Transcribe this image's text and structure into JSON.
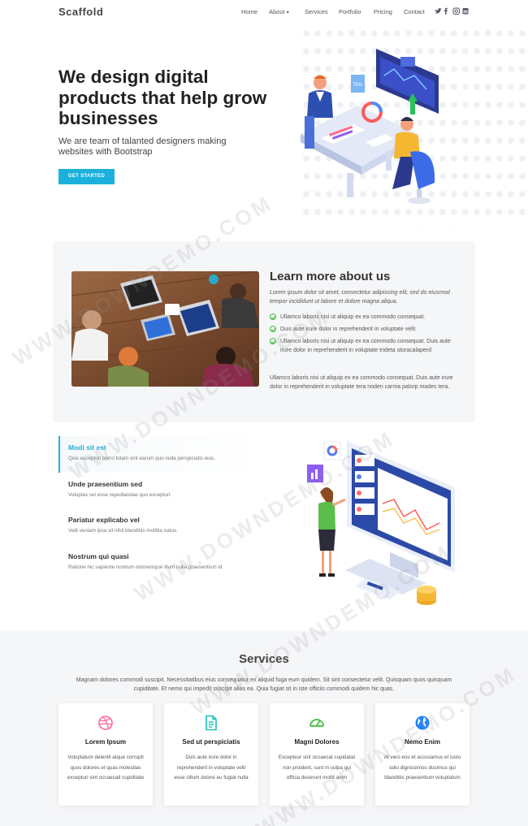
{
  "header": {
    "logo": "Scaffold",
    "nav": [
      {
        "label": "Home"
      },
      {
        "label": "About"
      },
      {
        "label": "Services"
      },
      {
        "label": "Portfolio"
      },
      {
        "label": "Pricing"
      },
      {
        "label": "Contact"
      }
    ],
    "social_icons": [
      "twitter-icon",
      "facebook-icon",
      "instagram-icon",
      "linkedin-icon"
    ]
  },
  "hero": {
    "title": "We design digital products that help grow businesses",
    "subtitle": "We are team of talanted designers making websites with Bootstrap",
    "cta_label": "GET STARTED",
    "badge_text": "75%"
  },
  "about": {
    "title": "Learn more about us",
    "intro": "Lorem ipsum dolor sit amet, consectetur adipiscing elit, sed do eiusmod tempor incididunt ut labore et dolore magna aliqua.",
    "checks": [
      "Ullamco laboris nisi ut aliquip ex ea commodo consequat.",
      "Duis aute irure dolor in reprehenderit in voluptate velit.",
      "Ullamco laboris nisi ut aliquip ex ea commodo consequat. Duis aute irure dolor in reprehenderit in voluptate trideta storacalaperd"
    ],
    "paragraph": "Ullamco laboris nisi ut aliquip ex ea commodo consequat. Duis aute irure dolor in reprehenderit in voluptate tera noden carma palorp mades tera."
  },
  "tabs": [
    {
      "title": "Modi sit est",
      "desc": "Quis excepturi porro totam sint earum quo nulla perspiciatis eius."
    },
    {
      "title": "Unde praesentium sed",
      "desc": "Voluptas vel esse repudiandae quo excepturi."
    },
    {
      "title": "Pariatur explicabo vel",
      "desc": "Velit veniam ipsa sit nihil blanditiis mollitia natus."
    },
    {
      "title": "Nostrum qui quasi",
      "desc": "Ratione hic sapiente nostrum doloremque illum nulla praesentium id"
    }
  ],
  "services": {
    "title": "Services",
    "desc": "Magnam dolores commodi suscipit. Necessitatibus eius consequatur ex aliquid fuga eum quidem. Sit sint consectetur velit. Quisquam quos quisquam cupiditate. Et nemo qui impedit suscipit alias ea. Quia fugiat sit in iste officiis commodi quidem hic quas.",
    "cards": [
      {
        "icon": "dribbble-icon",
        "color": "#ff689b",
        "title": "Lorem Ipsum",
        "desc": "Voluptatum deleniti atque corrupti quos dolores et quas molestias excepturi sint occaecati cupiditate"
      },
      {
        "icon": "document-icon",
        "color": "#19c2b9",
        "title": "Sed ut perspiciatis",
        "desc": "Duis aute irure dolor in reprehenderit in voluptate velit esse cillum dolore eu fugiat nulla"
      },
      {
        "icon": "gauge-icon",
        "color": "#3ec13e",
        "title": "Magni Dolores",
        "desc": "Excepteur sint occaecat cupidatat non proident, sunt in culpa qui officia deserunt mollit anim"
      },
      {
        "icon": "globe-icon",
        "color": "#2282ff",
        "title": "Nemo Enim",
        "desc": "At vero eos et accusamus et iusto odio dignissimos ducimus qui blanditiis praesentium voluptatum"
      }
    ]
  },
  "colors": {
    "accent": "#1bb1dc",
    "check": "#3ec13e",
    "section_bg": "#f5f6f8"
  },
  "watermark": "WWW.DOWNDEMO.COM"
}
